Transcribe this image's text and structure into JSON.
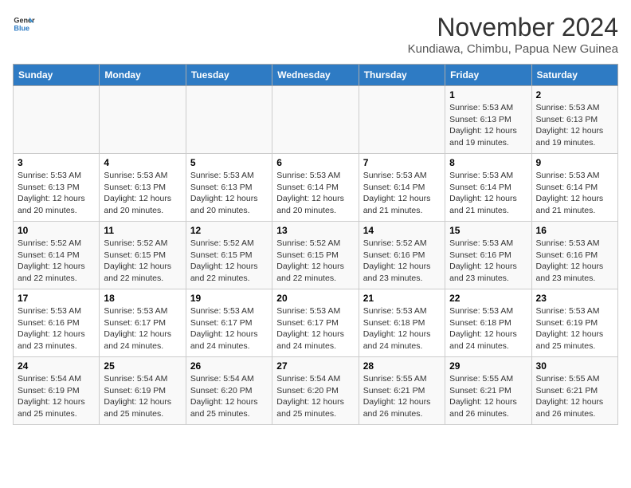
{
  "header": {
    "logo_line1": "General",
    "logo_line2": "Blue",
    "month_title": "November 2024",
    "subtitle": "Kundiawa, Chimbu, Papua New Guinea"
  },
  "calendar": {
    "days_of_week": [
      "Sunday",
      "Monday",
      "Tuesday",
      "Wednesday",
      "Thursday",
      "Friday",
      "Saturday"
    ],
    "weeks": [
      [
        {
          "day": "",
          "info": ""
        },
        {
          "day": "",
          "info": ""
        },
        {
          "day": "",
          "info": ""
        },
        {
          "day": "",
          "info": ""
        },
        {
          "day": "",
          "info": ""
        },
        {
          "day": "1",
          "info": "Sunrise: 5:53 AM\nSunset: 6:13 PM\nDaylight: 12 hours\nand 19 minutes."
        },
        {
          "day": "2",
          "info": "Sunrise: 5:53 AM\nSunset: 6:13 PM\nDaylight: 12 hours\nand 19 minutes."
        }
      ],
      [
        {
          "day": "3",
          "info": "Sunrise: 5:53 AM\nSunset: 6:13 PM\nDaylight: 12 hours\nand 20 minutes."
        },
        {
          "day": "4",
          "info": "Sunrise: 5:53 AM\nSunset: 6:13 PM\nDaylight: 12 hours\nand 20 minutes."
        },
        {
          "day": "5",
          "info": "Sunrise: 5:53 AM\nSunset: 6:13 PM\nDaylight: 12 hours\nand 20 minutes."
        },
        {
          "day": "6",
          "info": "Sunrise: 5:53 AM\nSunset: 6:14 PM\nDaylight: 12 hours\nand 20 minutes."
        },
        {
          "day": "7",
          "info": "Sunrise: 5:53 AM\nSunset: 6:14 PM\nDaylight: 12 hours\nand 21 minutes."
        },
        {
          "day": "8",
          "info": "Sunrise: 5:53 AM\nSunset: 6:14 PM\nDaylight: 12 hours\nand 21 minutes."
        },
        {
          "day": "9",
          "info": "Sunrise: 5:53 AM\nSunset: 6:14 PM\nDaylight: 12 hours\nand 21 minutes."
        }
      ],
      [
        {
          "day": "10",
          "info": "Sunrise: 5:52 AM\nSunset: 6:14 PM\nDaylight: 12 hours\nand 22 minutes."
        },
        {
          "day": "11",
          "info": "Sunrise: 5:52 AM\nSunset: 6:15 PM\nDaylight: 12 hours\nand 22 minutes."
        },
        {
          "day": "12",
          "info": "Sunrise: 5:52 AM\nSunset: 6:15 PM\nDaylight: 12 hours\nand 22 minutes."
        },
        {
          "day": "13",
          "info": "Sunrise: 5:52 AM\nSunset: 6:15 PM\nDaylight: 12 hours\nand 22 minutes."
        },
        {
          "day": "14",
          "info": "Sunrise: 5:52 AM\nSunset: 6:16 PM\nDaylight: 12 hours\nand 23 minutes."
        },
        {
          "day": "15",
          "info": "Sunrise: 5:53 AM\nSunset: 6:16 PM\nDaylight: 12 hours\nand 23 minutes."
        },
        {
          "day": "16",
          "info": "Sunrise: 5:53 AM\nSunset: 6:16 PM\nDaylight: 12 hours\nand 23 minutes."
        }
      ],
      [
        {
          "day": "17",
          "info": "Sunrise: 5:53 AM\nSunset: 6:16 PM\nDaylight: 12 hours\nand 23 minutes."
        },
        {
          "day": "18",
          "info": "Sunrise: 5:53 AM\nSunset: 6:17 PM\nDaylight: 12 hours\nand 24 minutes."
        },
        {
          "day": "19",
          "info": "Sunrise: 5:53 AM\nSunset: 6:17 PM\nDaylight: 12 hours\nand 24 minutes."
        },
        {
          "day": "20",
          "info": "Sunrise: 5:53 AM\nSunset: 6:17 PM\nDaylight: 12 hours\nand 24 minutes."
        },
        {
          "day": "21",
          "info": "Sunrise: 5:53 AM\nSunset: 6:18 PM\nDaylight: 12 hours\nand 24 minutes."
        },
        {
          "day": "22",
          "info": "Sunrise: 5:53 AM\nSunset: 6:18 PM\nDaylight: 12 hours\nand 24 minutes."
        },
        {
          "day": "23",
          "info": "Sunrise: 5:53 AM\nSunset: 6:19 PM\nDaylight: 12 hours\nand 25 minutes."
        }
      ],
      [
        {
          "day": "24",
          "info": "Sunrise: 5:54 AM\nSunset: 6:19 PM\nDaylight: 12 hours\nand 25 minutes."
        },
        {
          "day": "25",
          "info": "Sunrise: 5:54 AM\nSunset: 6:19 PM\nDaylight: 12 hours\nand 25 minutes."
        },
        {
          "day": "26",
          "info": "Sunrise: 5:54 AM\nSunset: 6:20 PM\nDaylight: 12 hours\nand 25 minutes."
        },
        {
          "day": "27",
          "info": "Sunrise: 5:54 AM\nSunset: 6:20 PM\nDaylight: 12 hours\nand 25 minutes."
        },
        {
          "day": "28",
          "info": "Sunrise: 5:55 AM\nSunset: 6:21 PM\nDaylight: 12 hours\nand 26 minutes."
        },
        {
          "day": "29",
          "info": "Sunrise: 5:55 AM\nSunset: 6:21 PM\nDaylight: 12 hours\nand 26 minutes."
        },
        {
          "day": "30",
          "info": "Sunrise: 5:55 AM\nSunset: 6:21 PM\nDaylight: 12 hours\nand 26 minutes."
        }
      ]
    ]
  }
}
